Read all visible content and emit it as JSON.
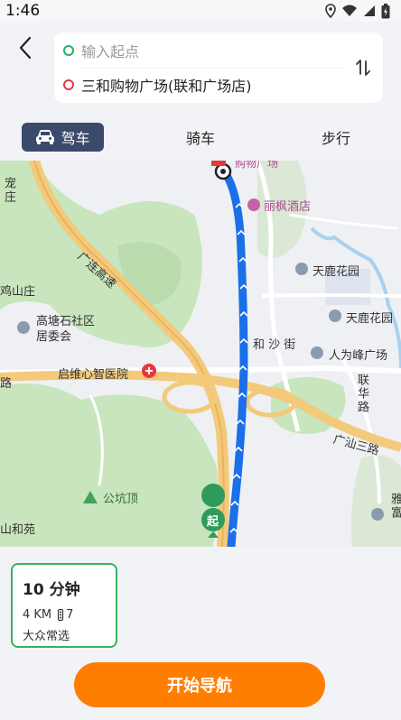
{
  "status": {
    "time": "1:46"
  },
  "route": {
    "start_placeholder": "输入起点",
    "destination": "三和购物广场(联和广场店)"
  },
  "modes": {
    "drive": "驾车",
    "bike": "骑车",
    "walk": "步行"
  },
  "map": {
    "labels": {
      "liangfeng_hotel": "丽枫酒店",
      "tianlu_garden_1": "天鹿花园",
      "tianlu_garden_2": "天鹿花园",
      "guanglian_expressway": "广连高速",
      "heshajie": "和 沙 街",
      "renweifeng": "人为峰广场",
      "gaotang": "高塘石社区居委会",
      "hospital": "启维心智医院",
      "lianhualu": "联华路",
      "guangshan_3": "广汕三路",
      "gongkeng": "公坑顶",
      "ya": "雅富",
      "hongshan": "鸡山庄",
      "chong_zhuang": "宠庄",
      "heyuan": "山和苑",
      "road_lu": "路",
      "start_marker": "起",
      "top_place": "购物广场"
    }
  },
  "plan": {
    "duration": "10 分钟",
    "distance": "4 KM",
    "lights": "7",
    "tag": "大众常选"
  },
  "cta": {
    "start_nav": "开始导航"
  }
}
